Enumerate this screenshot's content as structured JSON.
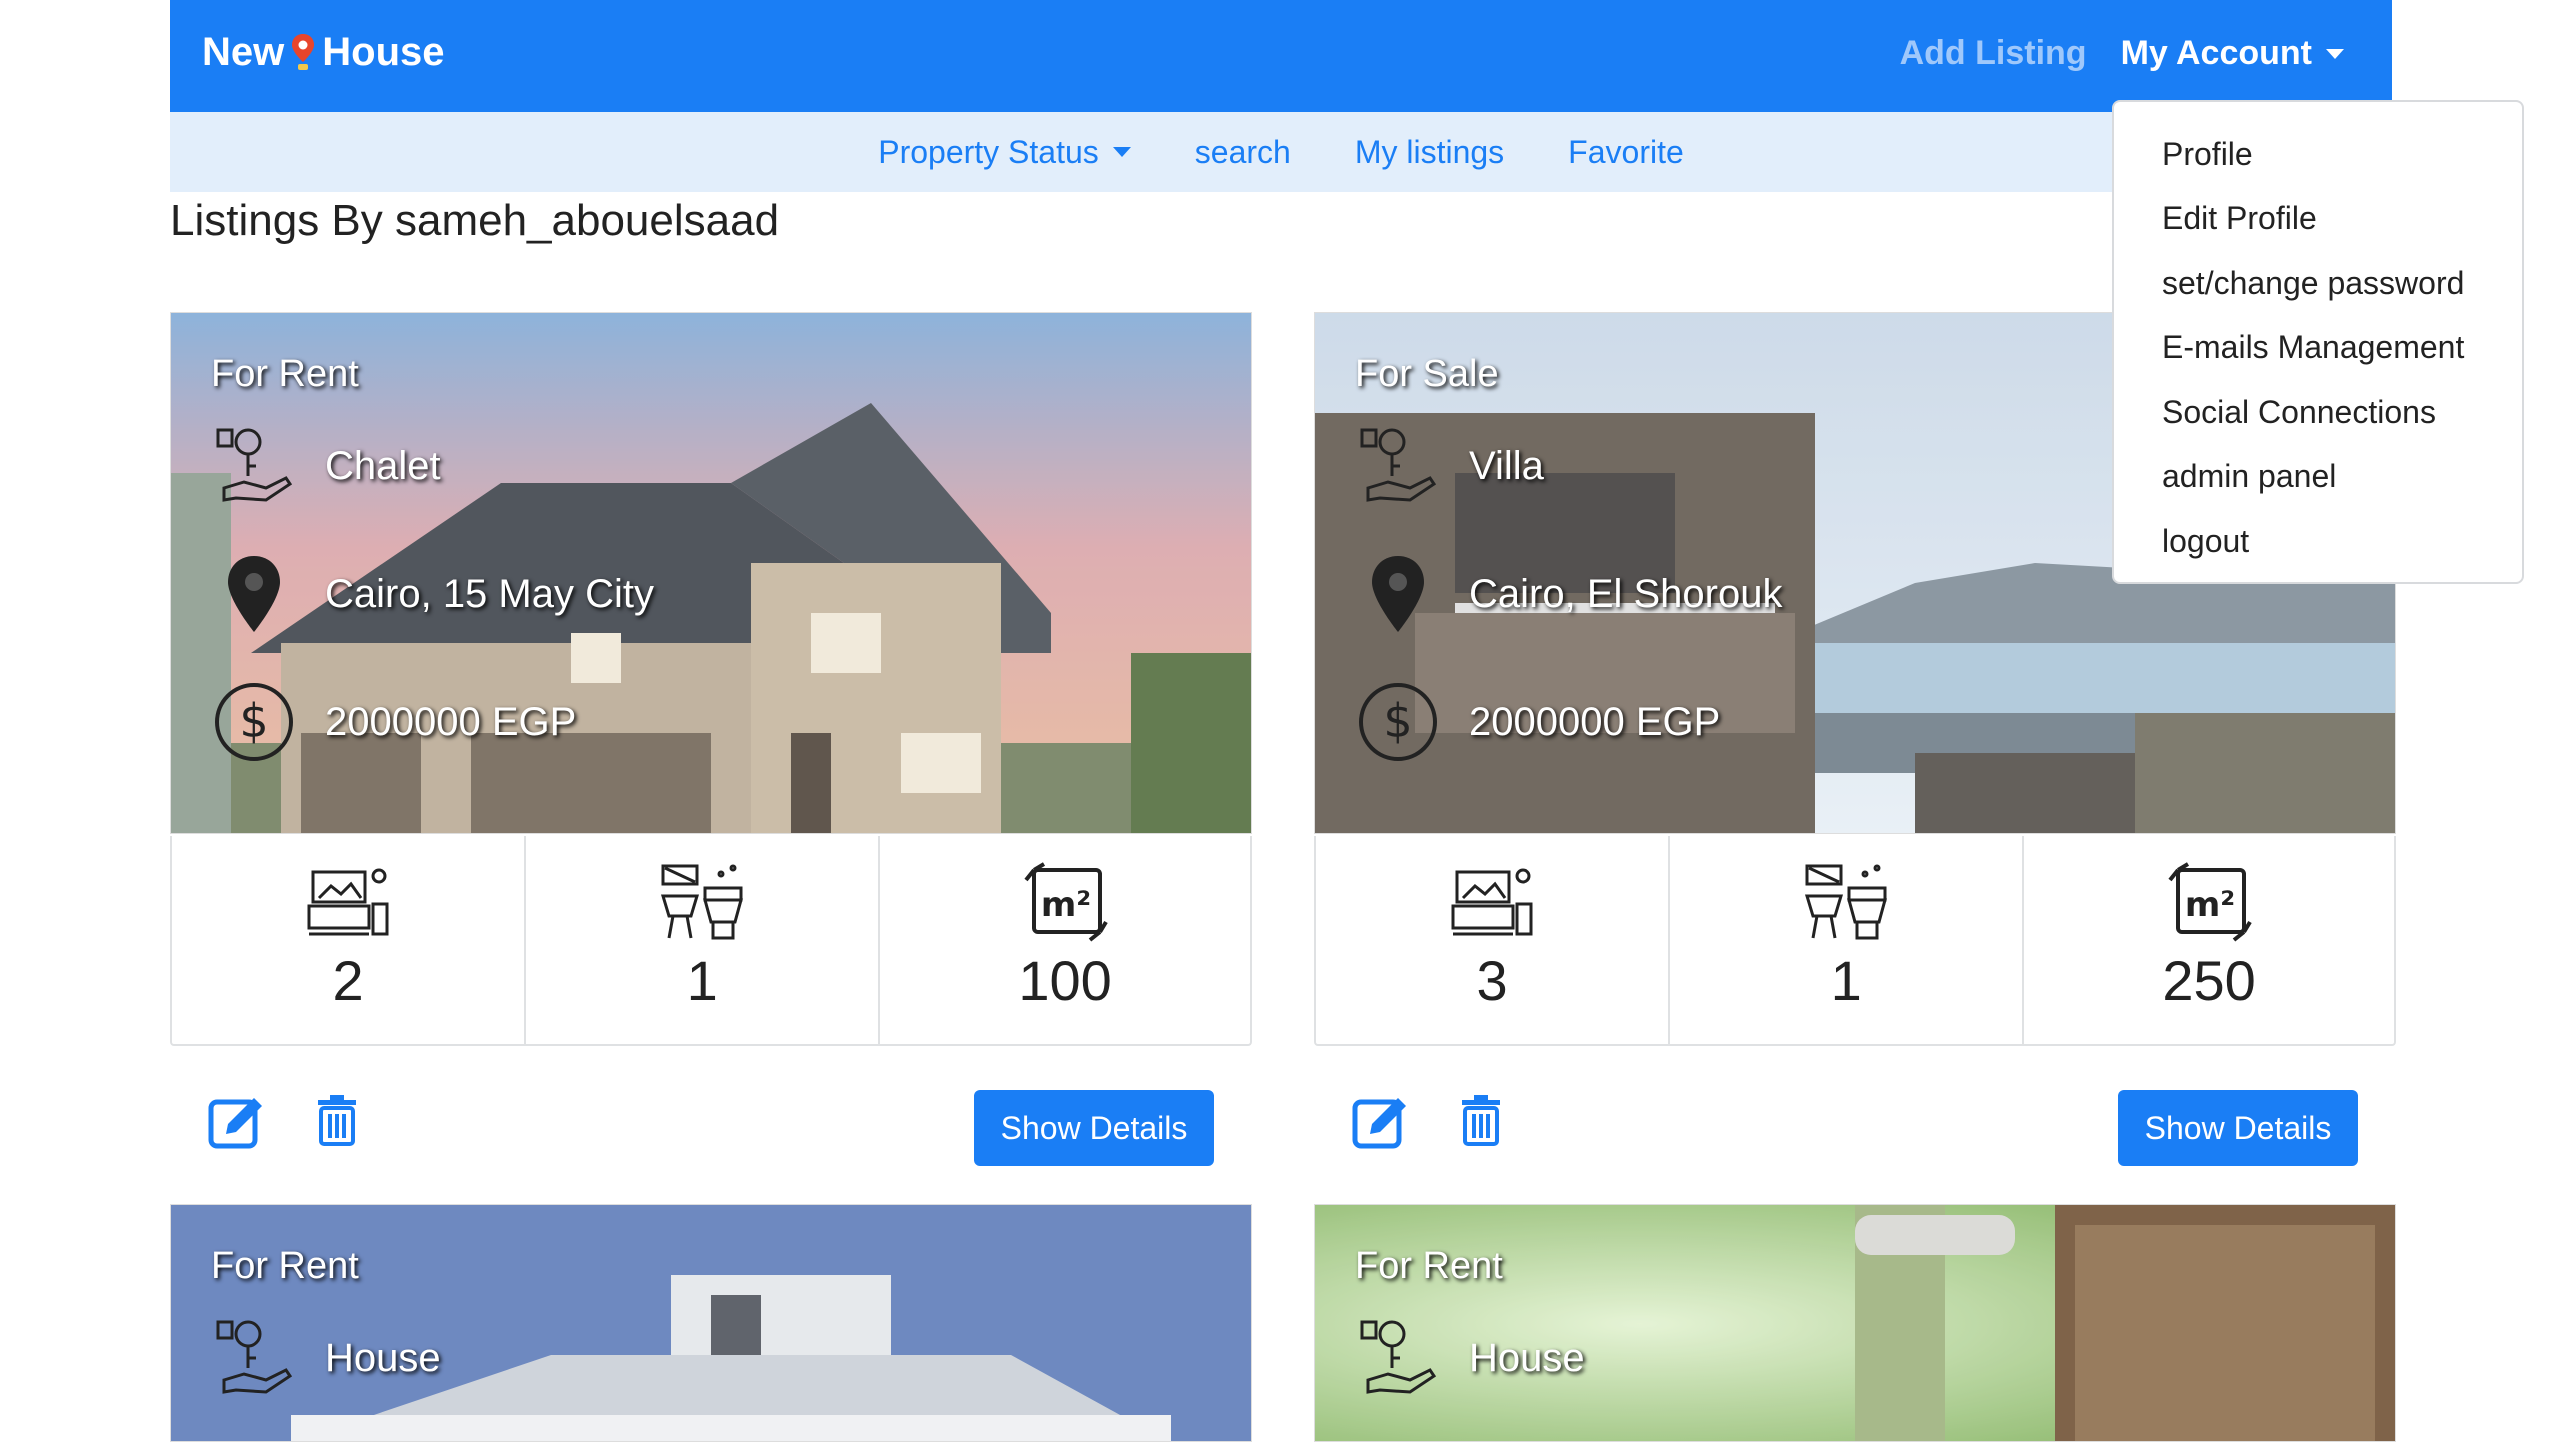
{
  "navbar": {
    "brand_left": "New",
    "brand_right": "House",
    "add_listing": "Add Listing",
    "my_account": "My Account"
  },
  "subnav": {
    "property_status": "Property Status",
    "search": "search",
    "my_listings": "My listings",
    "favorite": "Favorite"
  },
  "page_title": "Listings By sameh_abouelsaad",
  "account_menu": [
    "Profile",
    "Edit Profile",
    "set/change password",
    "E-mails Management",
    "Social Connections",
    "admin panel",
    "logout"
  ],
  "listings": [
    {
      "status": "For Rent",
      "type": "Chalet",
      "location": "Cairo, 15 May City",
      "price": "2000000 EGP",
      "bedrooms": "2",
      "bathrooms": "1",
      "area": "100",
      "details_label": "Show Details"
    },
    {
      "status": "For Sale",
      "type": "Villa",
      "location": "Cairo, El Shorouk",
      "price": "2000000 EGP",
      "bedrooms": "3",
      "bathrooms": "1",
      "area": "250",
      "details_label": "Show Details"
    },
    {
      "status": "For Rent",
      "type": "House"
    },
    {
      "status": "For Rent",
      "type": "House"
    }
  ],
  "area_unit_icon_text": "m²",
  "colors": {
    "primary": "#1a7ef5",
    "subnav_bg": "#e2eefb",
    "add_listing": "#9fc8fb"
  }
}
